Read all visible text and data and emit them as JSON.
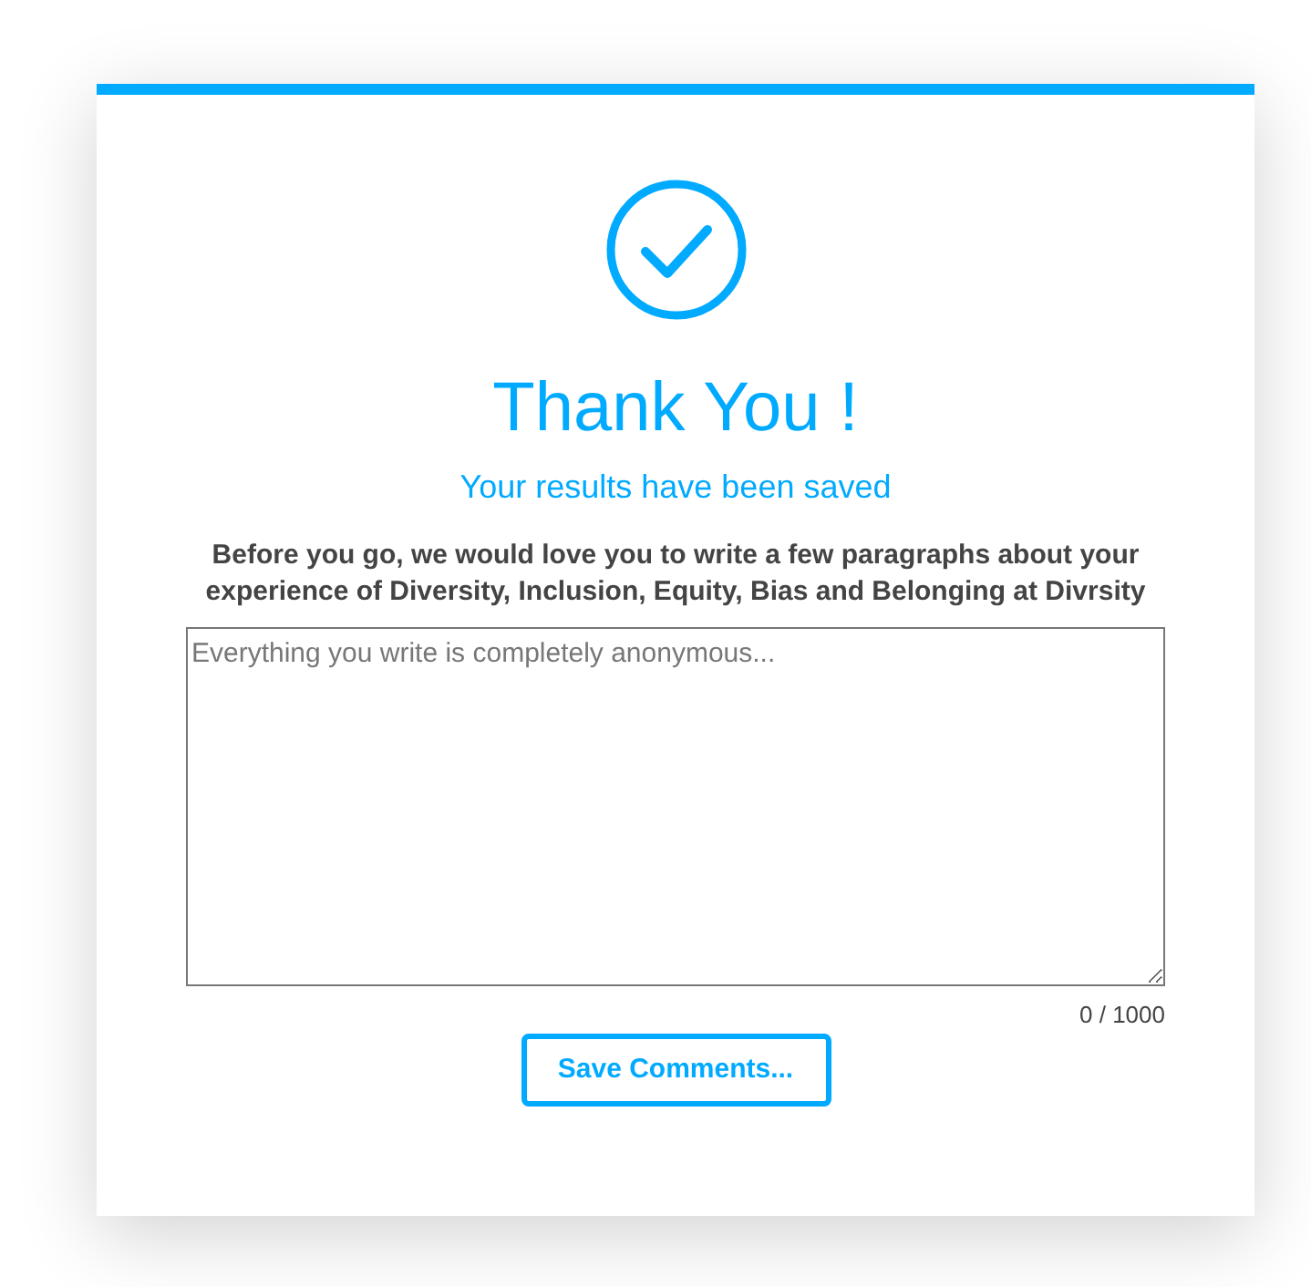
{
  "title": "Thank You !",
  "subtitle": "Your results have been saved",
  "prompt": "Before you go, we would love you to write a few paragraphs about your experience of Diversity, Inclusion, Equity, Bias and Belonging at Divrsity",
  "comment_field": {
    "placeholder": "Everything you write is completely anonymous..."
  },
  "counter": "0 / 1000",
  "button": "Save Comments..."
}
